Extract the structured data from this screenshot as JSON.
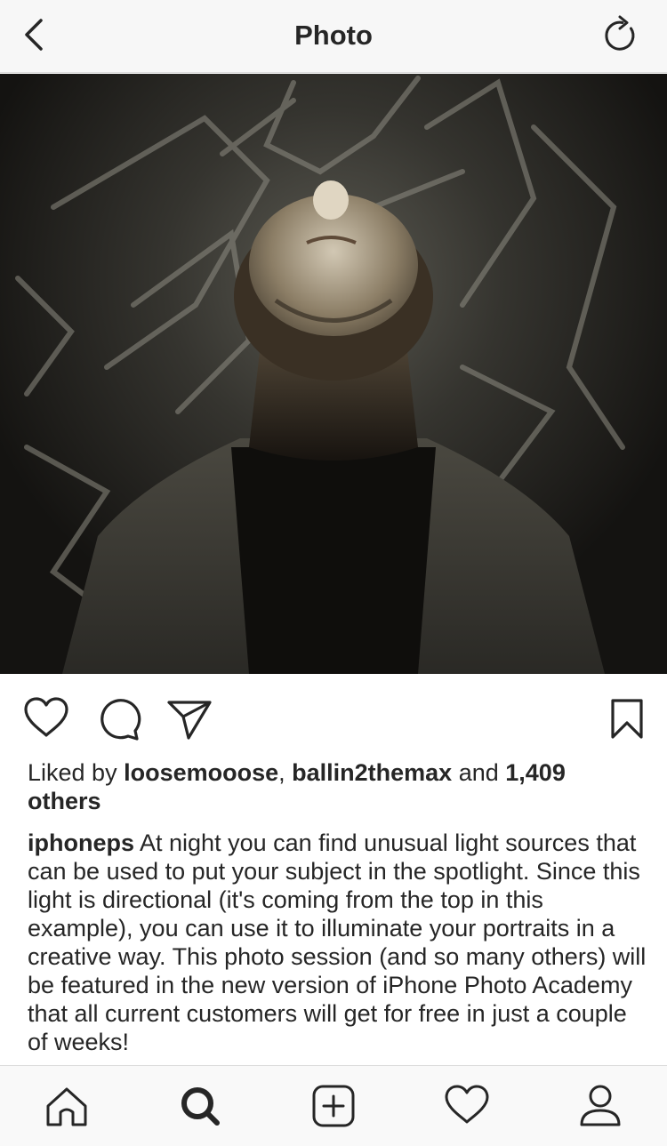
{
  "navbar": {
    "title": "Photo",
    "back_icon": "chevron-left-icon",
    "refresh_icon": "refresh-icon"
  },
  "post": {
    "photo_description": "Portrait of a person looking up into a spotlight in a dark room",
    "actions": {
      "like_icon": "heart-icon",
      "comment_icon": "comment-icon",
      "share_icon": "send-icon",
      "save_icon": "bookmark-icon"
    },
    "likes": {
      "prefix": "Liked by ",
      "user1": "loosemooose",
      "separator": ", ",
      "user2": "ballin2themax",
      "conjunction": " and ",
      "count": "1,409",
      "suffix": " others"
    },
    "caption": {
      "username": "iphoneps",
      "text": " At night you can find unusual light sources that can be used to put your subject in the spotlight. Since this light is directional (it's coming from the top in this example), you can use it to illuminate your portraits in a creative way. This photo session (and so many others) will be featured in the new version of iPhone Photo Academy that all current customers will get for free in just a couple of weeks!"
    }
  },
  "tabbar": {
    "items": [
      {
        "name": "home",
        "icon": "home-icon"
      },
      {
        "name": "search",
        "icon": "search-icon",
        "active": true
      },
      {
        "name": "new-post",
        "icon": "plus-square-icon"
      },
      {
        "name": "activity",
        "icon": "heart-icon"
      },
      {
        "name": "profile",
        "icon": "user-icon"
      }
    ]
  },
  "colors": {
    "text": "#262626",
    "bar_background": "#f7f7f7",
    "divider": "#dbdbdb"
  }
}
